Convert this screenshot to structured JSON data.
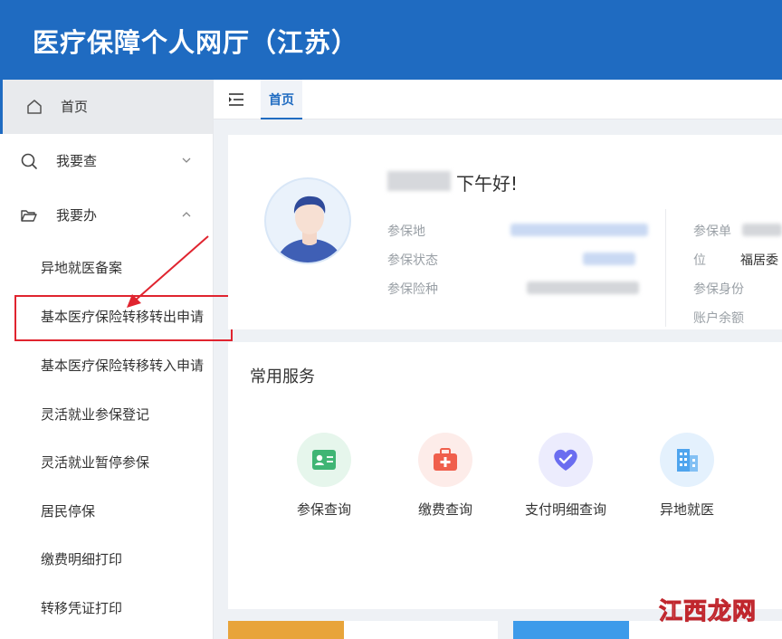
{
  "app": {
    "title": "医疗保障个人网厅（江苏）"
  },
  "sidebar": {
    "home": "首页",
    "query": "我要查",
    "handle": "我要办",
    "sub_items": [
      "异地就医备案",
      "基本医疗保险转移转出申请",
      "基本医疗保险转移转入申请",
      "灵活就业参保登记",
      "灵活就业暂停参保",
      "居民停保",
      "缴费明细打印",
      "转移凭证打印"
    ]
  },
  "topbar": {
    "tab_home": "首页"
  },
  "profile": {
    "greeting": "下午好!",
    "left_fields": [
      "参保地",
      "参保状态",
      "参保险种"
    ],
    "right_fields": [
      "参保单",
      "位",
      "参保身份",
      "账户余额"
    ],
    "unit_value": "福居委"
  },
  "services": {
    "heading": "常用服务",
    "items": [
      {
        "label": "参保查询",
        "icon": "id-card-icon",
        "color": "#3fb574",
        "bg": "#e6f6ec"
      },
      {
        "label": "缴费查询",
        "icon": "medical-kit-icon",
        "color": "#f05f4c",
        "bg": "#fdece9"
      },
      {
        "label": "支付明细查询",
        "icon": "heart-check-icon",
        "color": "#6a6df0",
        "bg": "#ececfd"
      },
      {
        "label": "异地就医",
        "icon": "building-icon",
        "color": "#4ea4ee",
        "bg": "#e4f1fd"
      }
    ]
  },
  "watermark": "江西龙网",
  "colors": {
    "brand": "#1f6bc1",
    "highlight": "#e0242f"
  }
}
